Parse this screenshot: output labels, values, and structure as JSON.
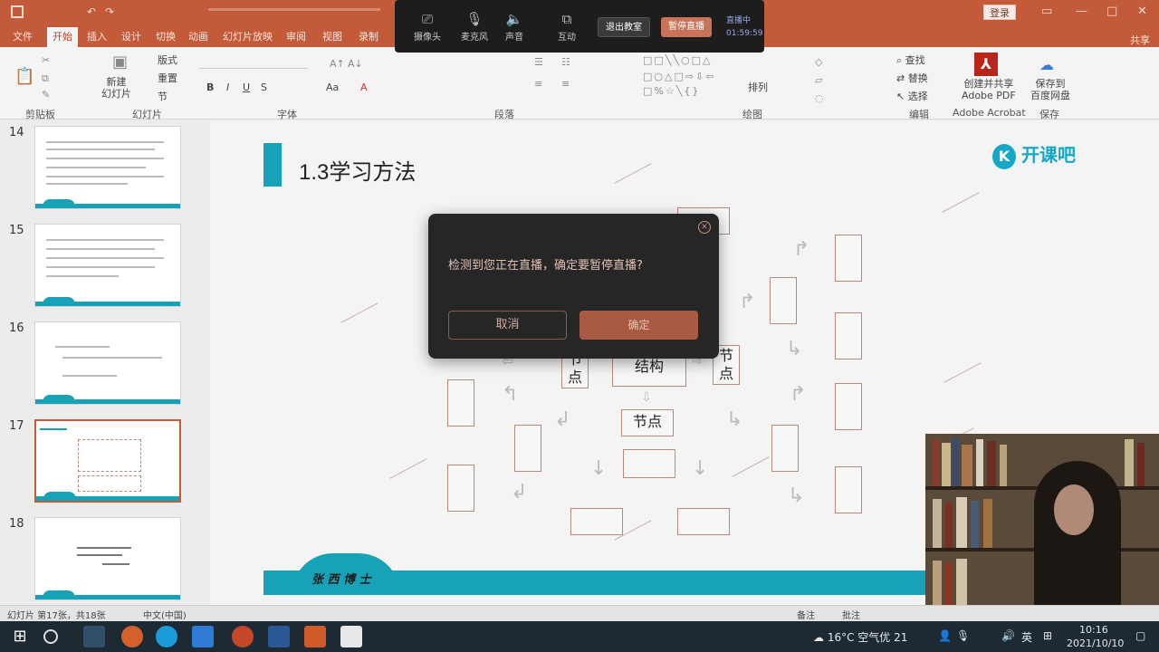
{
  "titlebar": {
    "login": "登录"
  },
  "tabs": [
    "文件",
    "开始",
    "插入",
    "设计",
    "切换",
    "动画",
    "幻灯片放映",
    "审阅",
    "视图",
    "录制"
  ],
  "share": "共享",
  "ribbon": {
    "new_slide": "新建\n幻灯片",
    "layout": "版式",
    "reset": "重置",
    "section": "节",
    "find": "查找",
    "replace": "替换",
    "select": "选择",
    "arrange": "排列",
    "create_pdf": "创建并共享\nAdobe PDF",
    "save_baidu": "保存到\n百度网盘",
    "groups": [
      "剪贴板",
      "幻灯片",
      "字体",
      "段落",
      "绘图",
      "编辑",
      "Adobe Acrobat",
      "保存"
    ]
  },
  "livebar": {
    "camera": "摄像头",
    "mic": "麦克风",
    "sound": "声音",
    "interact": "互动",
    "exit_class": "退出教室",
    "pause_live": "暂停直播",
    "status": "直播中\n01:59:59"
  },
  "thumbnails": [
    {
      "num": "14"
    },
    {
      "num": "15"
    },
    {
      "num": "16"
    },
    {
      "num": "17"
    },
    {
      "num": "18"
    }
  ],
  "slide": {
    "title": "1.3学习方法",
    "brand": "开课吧",
    "footer_sign": "张 西  博 士",
    "structure": "结构",
    "node_center": "节点",
    "node_left": "节\n点",
    "node_right": "节\n点"
  },
  "dialog": {
    "message": "检测到您正在直播，确定要暂停直播?",
    "cancel": "取消",
    "confirm": "确定"
  },
  "statusbar": {
    "left": "幻灯片 第17张，共18张",
    "lang": "中文(中国)",
    "notes": "备注",
    "comments": "批注"
  },
  "taskbar": {
    "weather": "16°C 空气优 21",
    "ime": "英",
    "time": "10:16",
    "date": "2021/10/10"
  },
  "colors": {
    "accent": "#c35a3a",
    "teal": "#17a2b8",
    "dialog_bg": "#262626"
  }
}
